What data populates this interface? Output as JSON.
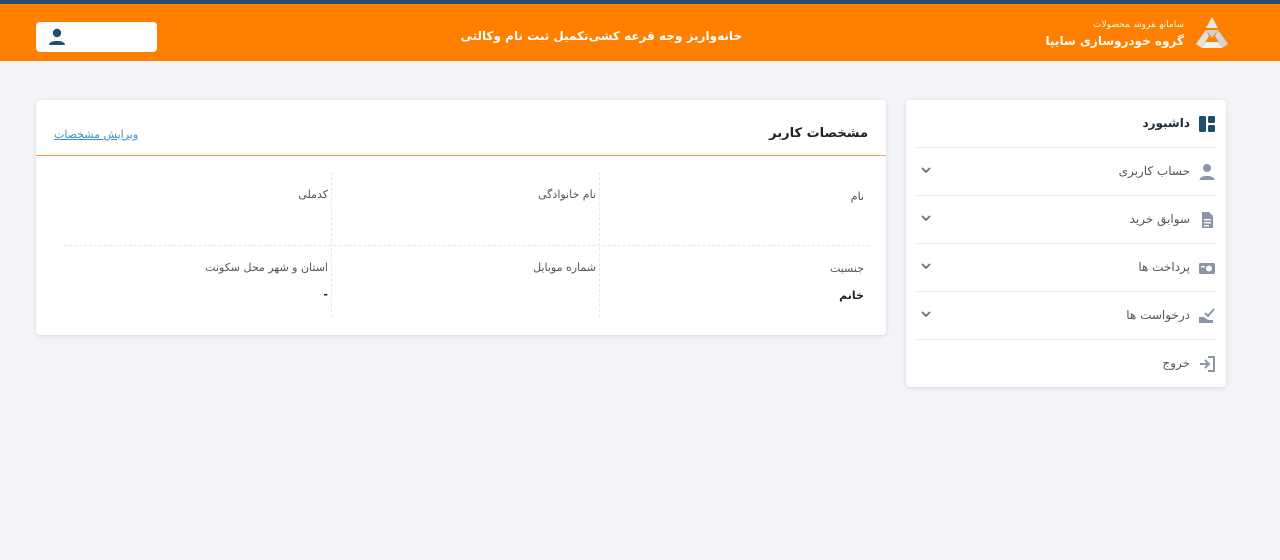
{
  "header": {
    "brand_sub": [
      "سامانه",
      "فروش",
      "محصولات"
    ],
    "brand_title": "گروه خودروسازی سایپا",
    "nav": [
      "خانه",
      "واریز وجه قرعه کشی",
      "تکمیل ثبت نام وکالتی"
    ],
    "user_icon": "user-icon",
    "colors": {
      "bar": "#ff7f00",
      "topline": "#2b4a6f"
    }
  },
  "sidebar": {
    "items": [
      {
        "label": "داشبورد",
        "icon": "dashboard-icon"
      },
      {
        "label": "حساب کاربری",
        "icon": "user-icon"
      },
      {
        "label": "سوابق خرید",
        "icon": "document-icon"
      },
      {
        "label": "پرداخت ها",
        "icon": "payment-icon"
      },
      {
        "label": "درخواست ها",
        "icon": "request-icon"
      },
      {
        "label": "خروج",
        "icon": "logout-icon"
      }
    ]
  },
  "profile": {
    "title": "مشخصات کاربر",
    "edit_link": "ویرایش مشخصات",
    "fields": [
      {
        "label": "نام",
        "value": ""
      },
      {
        "label": "نام خانوادگی",
        "value": ""
      },
      {
        "label": "کدملی",
        "value": ""
      },
      {
        "label": "جنسیت",
        "value": "خانم"
      },
      {
        "label": "شماره موبایل",
        "value": ""
      },
      {
        "label": "استان و شهر محل سکونت",
        "value": "-"
      }
    ]
  }
}
